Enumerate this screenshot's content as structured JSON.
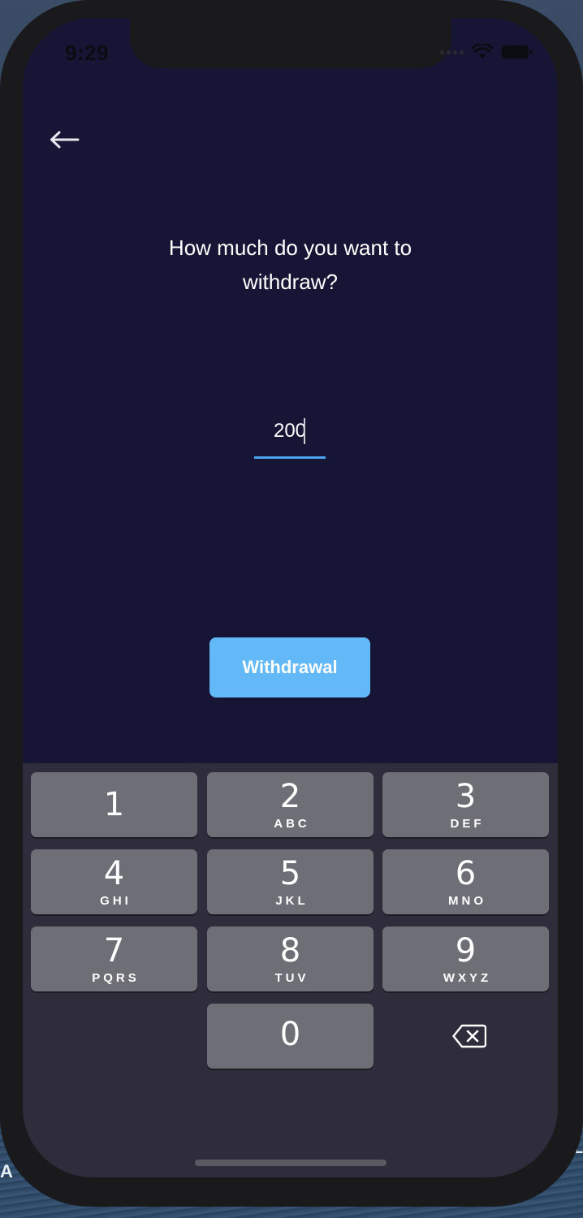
{
  "status_bar": {
    "time": "9:29"
  },
  "header": {
    "back_icon": "arrow-left-icon"
  },
  "prompt": {
    "line1": "How much do you want to",
    "line2": "withdraw?"
  },
  "amount_field": {
    "value": "200"
  },
  "action": {
    "label": "Withdrawal",
    "color": "#63b8f7"
  },
  "keypad": {
    "keys": [
      {
        "digit": "1",
        "letters": ""
      },
      {
        "digit": "2",
        "letters": "ABC"
      },
      {
        "digit": "3",
        "letters": "DEF"
      },
      {
        "digit": "4",
        "letters": "GHI"
      },
      {
        "digit": "5",
        "letters": "JKL"
      },
      {
        "digit": "6",
        "letters": "MNO"
      },
      {
        "digit": "7",
        "letters": "PQRS"
      },
      {
        "digit": "8",
        "letters": "TUV"
      },
      {
        "digit": "9",
        "letters": "WXYZ"
      },
      {
        "digit": "0",
        "letters": ""
      }
    ],
    "delete_icon": "backspace-icon"
  },
  "backdrop": {
    "left_text": "A",
    "right_text": "L"
  },
  "colors": {
    "background": "#171535",
    "keyboard": "#2f2d3b",
    "key": "#6e6e76",
    "accent_underline": "#4aa3ef"
  }
}
